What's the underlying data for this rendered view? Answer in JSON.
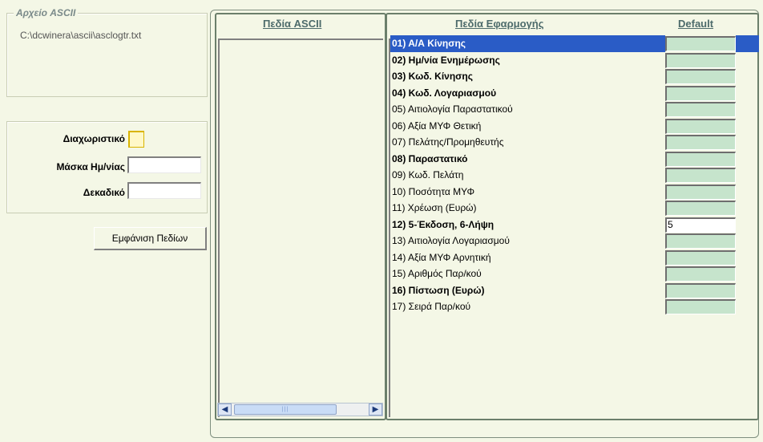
{
  "ascii_file": {
    "group_title": "Αρχείο ASCII",
    "path": "C:\\dcwinera\\ascii\\asclogtr.txt"
  },
  "settings": {
    "separator_label": "Διαχωριστικό",
    "separator_value": "",
    "date_mask_label": "Μάσκα Ημ/νίας",
    "date_mask_value": "",
    "decimal_label": "Δεκαδικό",
    "decimal_value": ""
  },
  "show_fields_button": "Εμφάνιση Πεδίων",
  "ascii_fields": {
    "header": "Πεδία ASCII",
    "items": []
  },
  "app_fields": {
    "header": "Πεδία Εφαρμογής",
    "default_header": "Default",
    "rows": [
      {
        "label": "01) Α/Α Κίνησης",
        "bold": true,
        "default": "",
        "selected": true
      },
      {
        "label": "02) Ημ/νία Ενημέρωσης",
        "bold": true,
        "default": ""
      },
      {
        "label": "03) Κωδ. Κίνησης",
        "bold": true,
        "default": ""
      },
      {
        "label": "04) Κωδ. Λογαριασμού",
        "bold": true,
        "default": ""
      },
      {
        "label": "05) Αιτιολογία Παραστατικού",
        "bold": false,
        "default": ""
      },
      {
        "label": "06) Αξία ΜΥΦ Θετική",
        "bold": false,
        "default": ""
      },
      {
        "label": "07) Πελάτης/Προμηθευτής",
        "bold": false,
        "default": ""
      },
      {
        "label": "08) Παραστατικό",
        "bold": true,
        "default": ""
      },
      {
        "label": "09) Κωδ. Πελάτη",
        "bold": false,
        "default": ""
      },
      {
        "label": "10) Ποσότητα ΜΥΦ",
        "bold": false,
        "default": ""
      },
      {
        "label": "11) Χρέωση (Ευρώ)",
        "bold": false,
        "default": ""
      },
      {
        "label": "12) 5-Έκδοση, 6-Λήψη",
        "bold": true,
        "default": "5"
      },
      {
        "label": "13) Αιτιολογία Λογαριασμού",
        "bold": false,
        "default": ""
      },
      {
        "label": "14) Αξία ΜΥΦ Αρνητική",
        "bold": false,
        "default": ""
      },
      {
        "label": "15) Αριθμός Παρ/κού",
        "bold": false,
        "default": ""
      },
      {
        "label": "16) Πίστωση (Ευρώ)",
        "bold": true,
        "default": ""
      },
      {
        "label": "17) Σειρά Παρ/κού",
        "bold": false,
        "default": ""
      }
    ]
  },
  "colors": {
    "background": "#f4f7e6",
    "selection": "#2a5cc6",
    "default_cell": "#c6e4cc",
    "header_text": "#4d6b6b"
  }
}
